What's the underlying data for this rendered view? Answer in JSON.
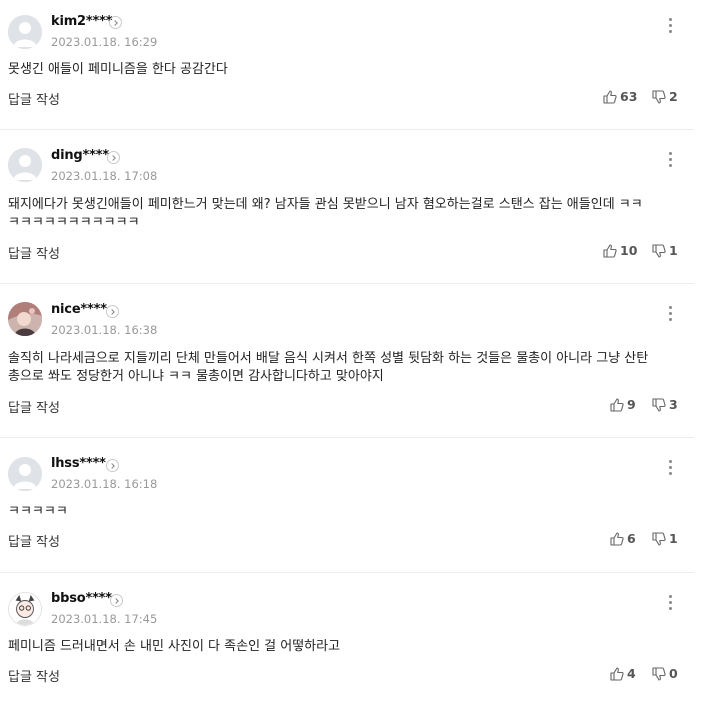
{
  "comments": [
    {
      "username": "kim2****",
      "date": "2023.01.18. 16:29",
      "text": "못생긴 애들이 페미니즘을 한다 공감간다",
      "reply_label": "답글 작성",
      "likes": "63",
      "dislikes": "2"
    },
    {
      "username": "ding****",
      "date": "2023.01.18. 17:08",
      "text": "돼지에다가 못생긴애들이 페미한느거 맞는데 왜? 남자들 관심 못받으니 남자 혐오하는걸로 스탠스 잡는 애들인데 ㅋㅋ ㅋㅋㅋㅋㅋㅋㅋㅋㅋㅋㅋ",
      "reply_label": "답글 작성",
      "likes": "10",
      "dislikes": "1"
    },
    {
      "username": "nice****",
      "date": "2023.01.18. 16:38",
      "text": "솔직히 나라세금으로 지들끼리 단체 만들어서 배달 음식 시켜서 한쪽 성별 뒷담화 하는 것들은 물총이 아니라 그냥 산탄 총으로 쏴도 정당한거 아니냐 ㅋㅋ 물총이면 감사합니다하고 맞아야지",
      "reply_label": "답글 작성",
      "likes": "9",
      "dislikes": "3"
    },
    {
      "username": "lhss****",
      "date": "2023.01.18. 16:18",
      "text": "ㅋㅋㅋㅋㅋ",
      "reply_label": "답글 작성",
      "likes": "6",
      "dislikes": "1"
    },
    {
      "username": "bbso****",
      "date": "2023.01.18. 17:45",
      "text": "페미니즘 드러내면서 손 내민 사진이 다 족손인 걸 어떻하라고",
      "reply_label": "답글 작성",
      "likes": "4",
      "dislikes": "0"
    }
  ]
}
